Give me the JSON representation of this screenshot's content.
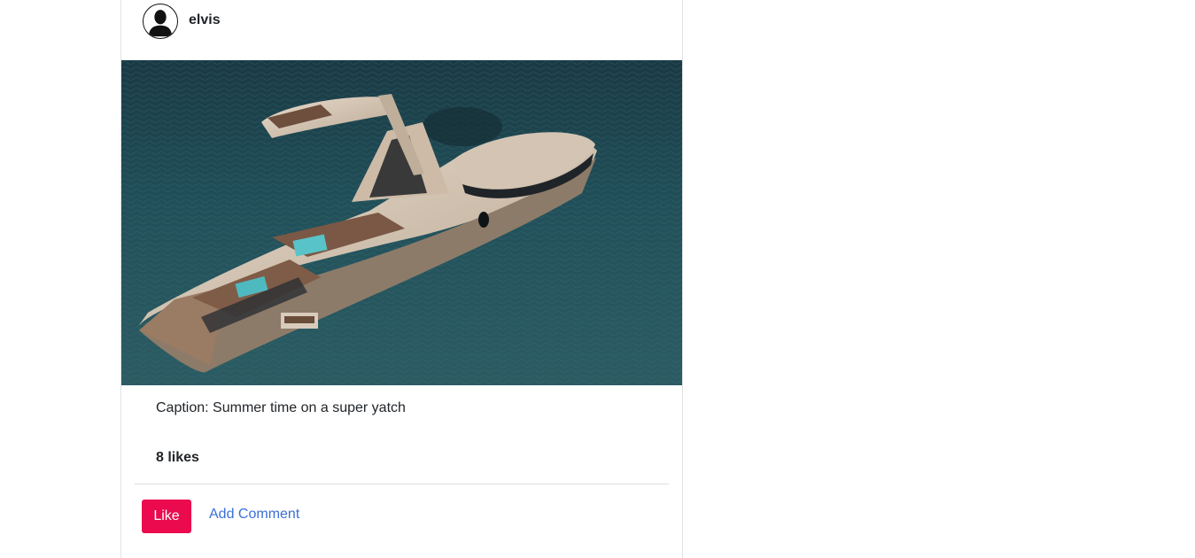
{
  "post": {
    "username": "elvis",
    "image_description": "super yacht on the sea",
    "caption": "Caption: Summer time on a super yatch",
    "likes_text": "8 likes",
    "like_button_label": "Like",
    "add_comment_label": "Add Comment"
  },
  "colors": {
    "like_button": "#ea0a4d",
    "link": "#3b6fd6",
    "sea_dark": "#15303a",
    "sea_mid": "#27555e",
    "yacht_hull": "#d8c6b4"
  },
  "icons": {
    "avatar": "user-silhouette-icon"
  }
}
